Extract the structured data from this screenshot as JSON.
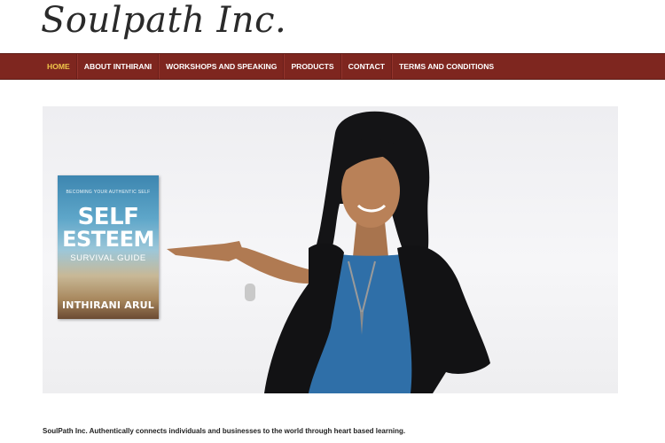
{
  "site": {
    "logo_text": "Soulpath Inc."
  },
  "nav": {
    "items": [
      {
        "label": "HOME",
        "active": true
      },
      {
        "label": "ABOUT INTHIRANI",
        "active": false
      },
      {
        "label": "WORKSHOPS AND SPEAKING",
        "active": false
      },
      {
        "label": "PRODUCTS",
        "active": false
      },
      {
        "label": "CONTACT",
        "active": false
      },
      {
        "label": "TERMS AND CONDITIONS",
        "active": false
      }
    ]
  },
  "hero": {
    "book": {
      "subtitle": "BECOMING YOUR AUTHENTIC SELF",
      "title_line1": "SELF",
      "title_line2": "ESTEEM",
      "title_line3": "SURVIVAL GUIDE",
      "author": "INTHIRANI ARUL"
    }
  },
  "footer": {
    "tagline": "SoulPath Inc. Authentically connects individuals and businesses to the world through heart based learning."
  },
  "colors": {
    "nav_background": "#7e261f",
    "nav_active": "#f0c74a",
    "nav_text": "#ffffff"
  }
}
